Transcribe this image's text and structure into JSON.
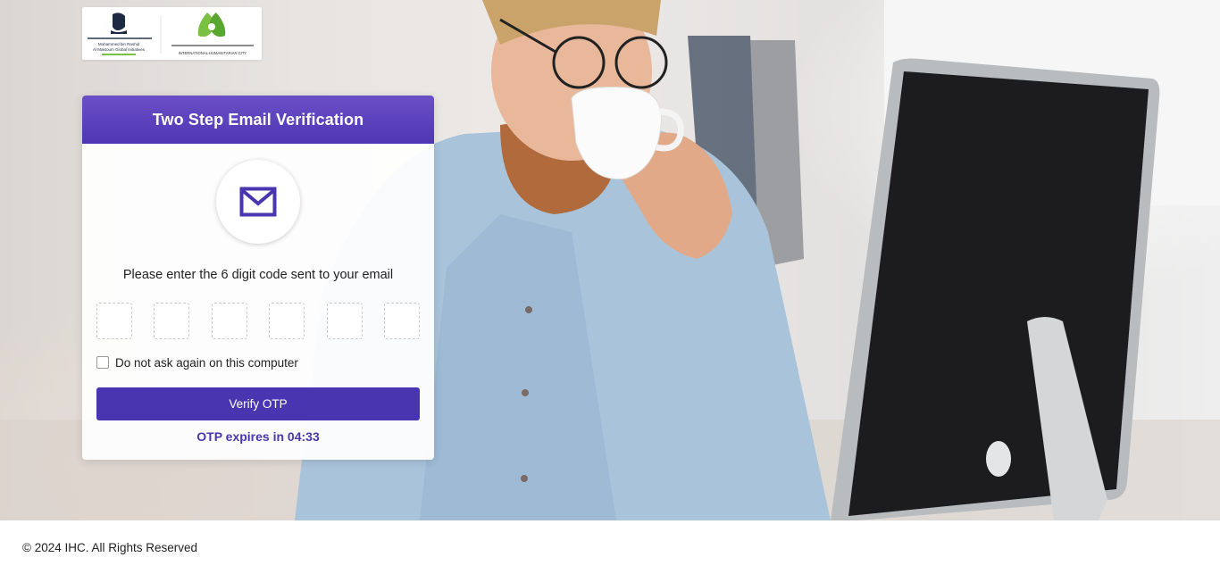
{
  "background": {
    "image": "man-drinking-coffee-at-desktop-computer"
  },
  "logos": {
    "left_text_line1": "Mohammed bin Rashid",
    "left_text_line2": "Al Maktoum Global Initiatives",
    "right_text": "INTERNATIONAL HUMANITARIAN CITY",
    "accent_green": "#79c043"
  },
  "card": {
    "title": "Two Step Email Verification",
    "icon": "envelope-icon",
    "instruction": "Please enter the 6 digit code sent to your email",
    "otp_digits": [
      "",
      "",
      "",
      "",
      "",
      ""
    ],
    "remember_label": "Do not ask again on this computer",
    "remember_checked": false,
    "verify_label": "Verify OTP",
    "expiry_text": "OTP expires in 04:33",
    "accent_color": "#4a35b0"
  },
  "footer": {
    "copyright": "© 2024 IHC. All Rights Reserved"
  }
}
